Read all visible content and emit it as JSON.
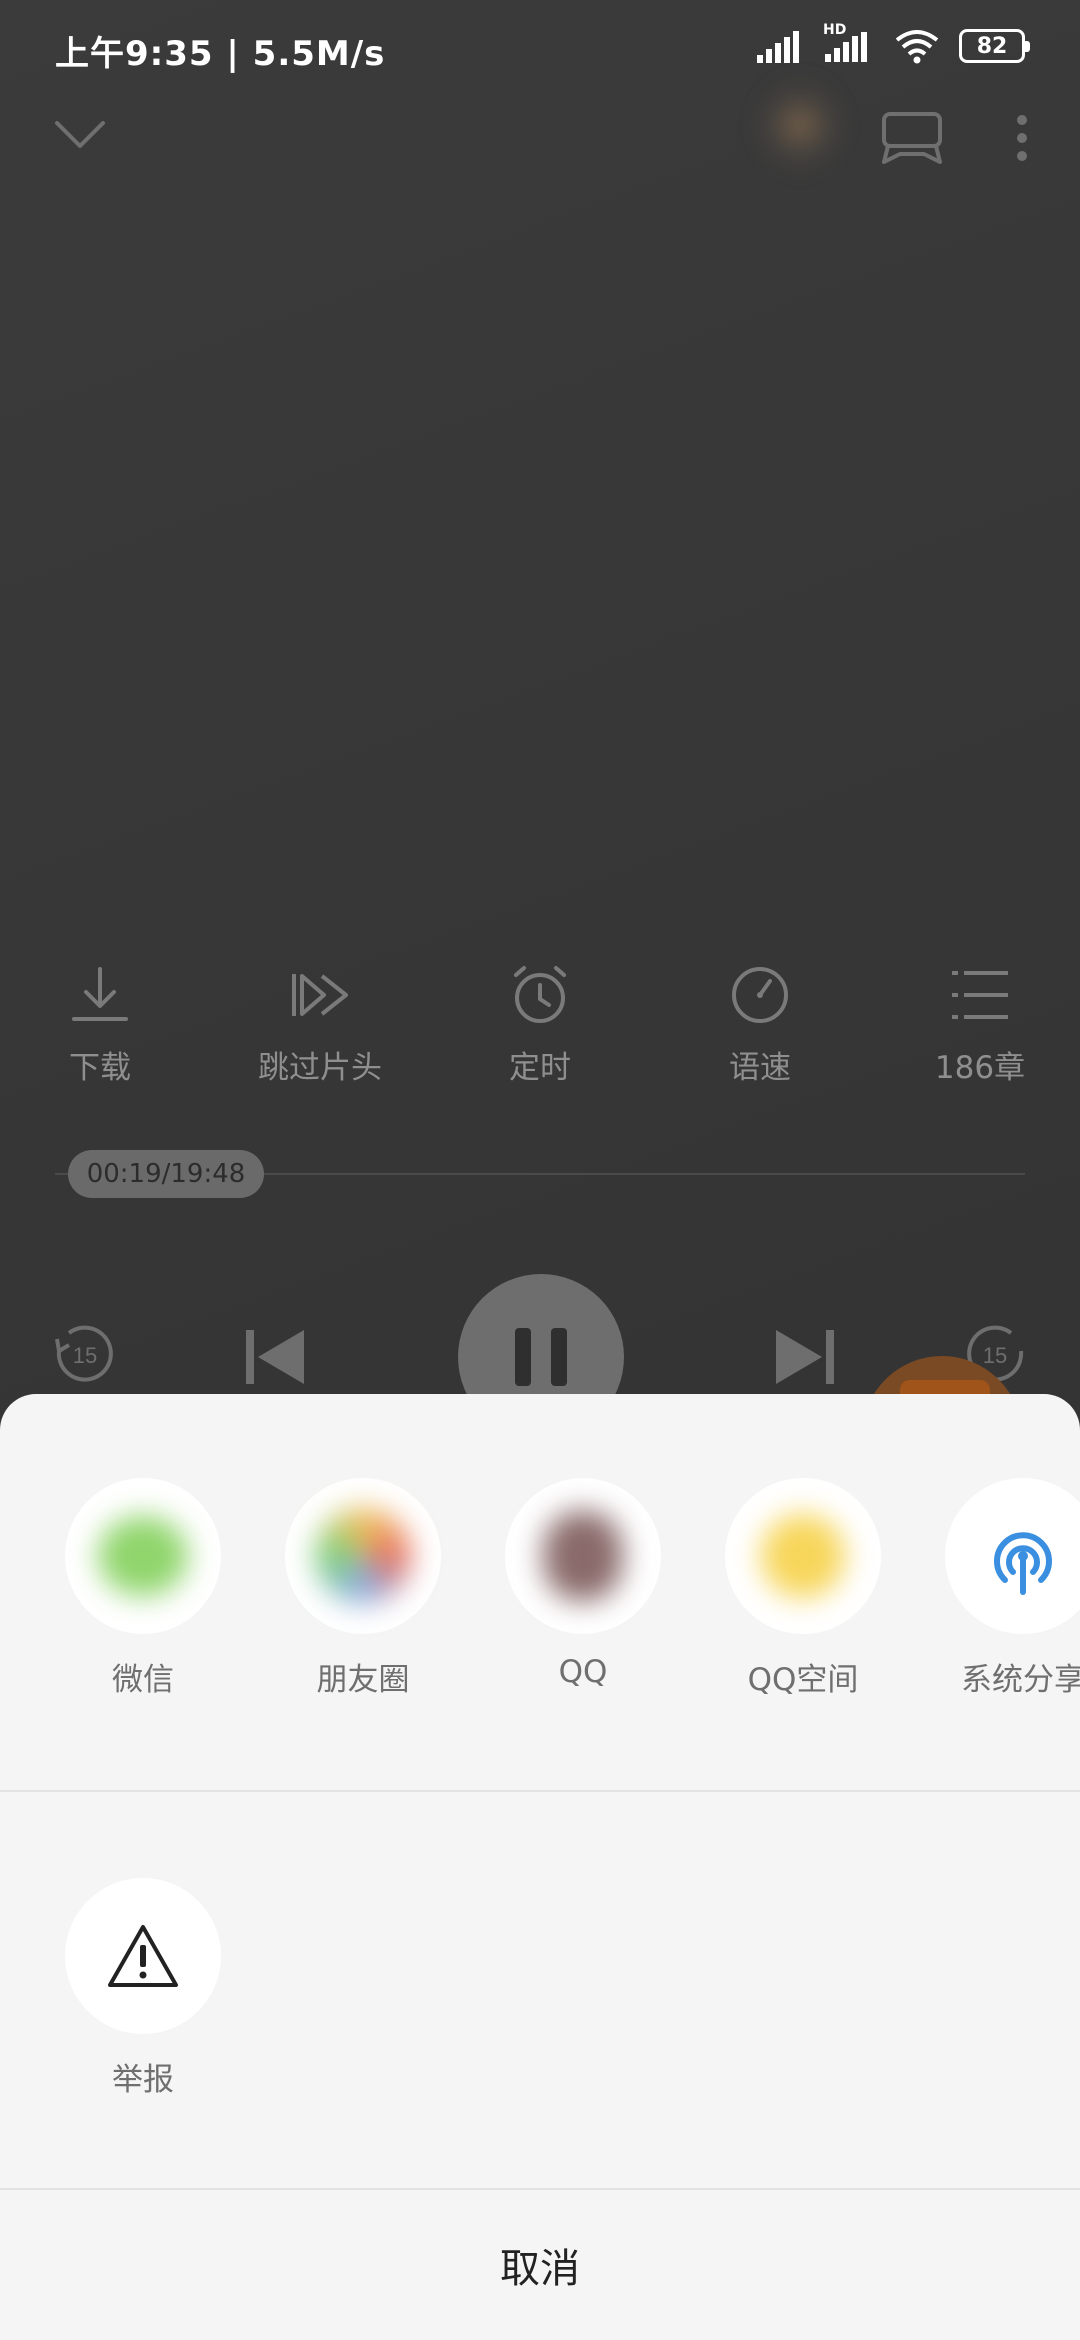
{
  "status_bar": {
    "time": "上午9:35 | 5.5M/s",
    "battery": "82",
    "network_label": "HD"
  },
  "player": {
    "functions": [
      {
        "label": "下载",
        "icon": "download-icon"
      },
      {
        "label": "跳过片头",
        "icon": "skip-intro-icon"
      },
      {
        "label": "定时",
        "icon": "alarm-clock-icon"
      },
      {
        "label": "语速",
        "icon": "speed-gauge-icon"
      },
      {
        "label": "186章",
        "icon": "chapter-list-icon"
      }
    ],
    "progress": {
      "time_text": "00:19/19:48",
      "fraction": 0.016
    },
    "rewind_seconds": "15",
    "forward_seconds": "15",
    "state": "playing"
  },
  "share_sheet": {
    "targets": [
      {
        "label": "微信",
        "icon": "wechat-icon",
        "color": "#8fd56b"
      },
      {
        "label": "朋友圈",
        "icon": "moments-icon",
        "color": "#e88a5b"
      },
      {
        "label": "QQ",
        "icon": "qq-icon",
        "color": "#8a6a6a"
      },
      {
        "label": "QQ空间",
        "icon": "qzone-icon",
        "color": "#f7d65a"
      },
      {
        "label": "系统分享",
        "icon": "system-share-icon",
        "color": "#3a8fe0"
      }
    ],
    "report": {
      "label": "举报",
      "icon": "warning-icon"
    },
    "cancel_label": "取消"
  }
}
